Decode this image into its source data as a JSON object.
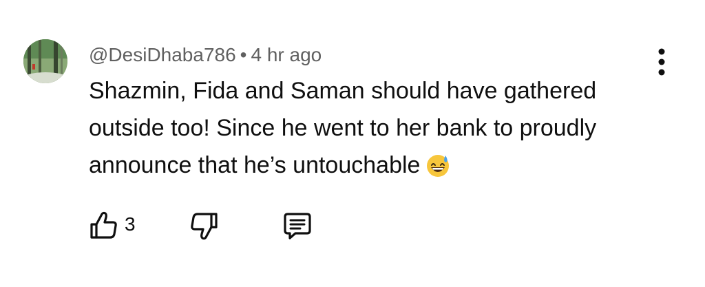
{
  "comment": {
    "author": "@DesiDhaba786",
    "separator": "•",
    "time": "4 hr ago",
    "text": "Shazmin, Fida and Saman should have gathered outside too! Since he went to her bank to proudly announce that he’s untouchable",
    "emoji": "grinning-face-with-sweat-icon",
    "like_count": "3"
  },
  "icons": {
    "menu": "more-vert-icon",
    "like": "thumb-up-icon",
    "dislike": "thumb-down-icon",
    "reply": "comment-icon"
  },
  "colors": {
    "text": "#0f0f0f",
    "meta": "#606060"
  }
}
